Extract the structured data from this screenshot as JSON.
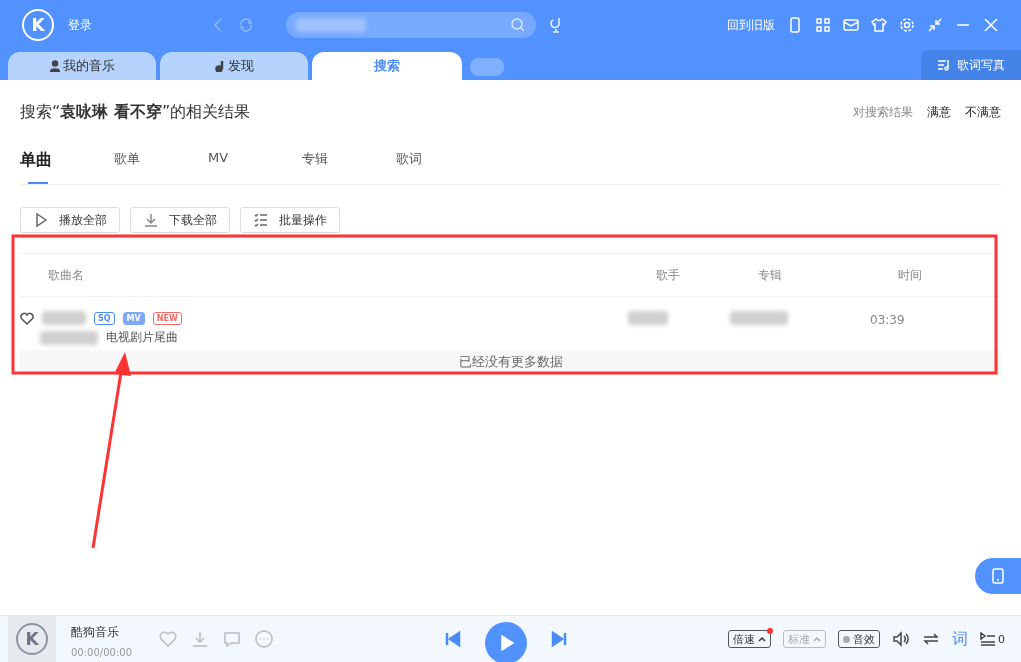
{
  "header": {
    "logo": "K",
    "login": "登录",
    "old_version": "回到旧版"
  },
  "nav_tabs": [
    {
      "label": "我的音乐",
      "kind": "person",
      "selected": false
    },
    {
      "label": "发现",
      "kind": "note",
      "selected": false
    },
    {
      "label": "搜索",
      "kind": "plain",
      "selected": true
    }
  ],
  "lyrics_photo": "歌词写真",
  "result_title": "搜索“**袁咏琳 看不穿**”的相关结果",
  "feedback": {
    "prompt": "对搜索结果",
    "options": [
      "满意",
      "不满意"
    ]
  },
  "category_tabs": [
    {
      "label": "单曲",
      "selected": true
    },
    {
      "label": "歌单",
      "selected": false
    },
    {
      "label": "MV",
      "selected": false
    },
    {
      "label": "专辑",
      "selected": false
    },
    {
      "label": "歌词",
      "selected": false
    }
  ],
  "actions": [
    {
      "label": "播放全部",
      "kind": "play"
    },
    {
      "label": "下载全部",
      "kind": "download"
    },
    {
      "label": "批量操作",
      "kind": "batch"
    }
  ],
  "table": {
    "columns": [
      "歌曲名",
      "歌手",
      "专辑",
      "时间"
    ],
    "rows": [
      {
        "favorite": false,
        "tags": [
          {
            "label": "SQ",
            "kind": "outline",
            "color": "#4a8cf7"
          },
          {
            "label": "MV",
            "kind": "filled",
            "color": "#7ea9f7"
          },
          {
            "label": "NEW",
            "kind": "outline",
            "color": "#f26a6a"
          }
        ],
        "note": "电视剧片尾曲",
        "duration": "03:39"
      }
    ]
  },
  "end_message": "已经没有更多数据",
  "player": {
    "logo": "K",
    "title": "酷狗音乐",
    "time": "00:00/00:00",
    "speed": "倍速",
    "quality": "标准",
    "quality_disabled": true,
    "effect": "音效",
    "lyrics": "词",
    "queue_count": "0"
  }
}
